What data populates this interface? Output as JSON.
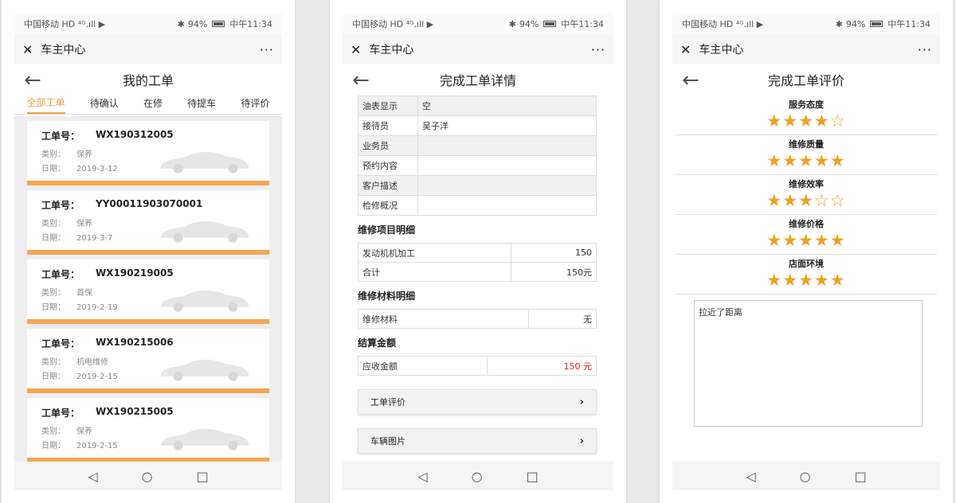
{
  "status": {
    "carrier": "中国移动",
    "carrier_tags": "HD ⁴ᴳ.ıll ▶",
    "battery": "94%",
    "time": "中午11:34"
  },
  "wx": {
    "title": "车主中心",
    "close": "✕",
    "more": "···"
  },
  "icons": {
    "back": "arrow-left-icon",
    "close": "close-icon",
    "more": "more-icon"
  },
  "colors": {
    "accent": "#f0a048",
    "card_bar": "#f4a751",
    "amount": "#d22222",
    "star": "#f0a020"
  },
  "nav": {
    "back": "◁",
    "home": "○",
    "recent": "□"
  },
  "phone1": {
    "title": "我的工单",
    "tabs": [
      "全部工单",
      "待确认",
      "在修",
      "待提车",
      "待评价"
    ],
    "orders": [
      {
        "no_label": "工单号：",
        "no": "WX190312005",
        "type_label": "类别：",
        "type": "保养",
        "date_label": "日期：",
        "date": "2019-3-12"
      },
      {
        "no_label": "工单号：",
        "no": "YY00011903070001",
        "type_label": "类别：",
        "type": "保养",
        "date_label": "日期：",
        "date": "2019-3-7"
      },
      {
        "no_label": "工单号：",
        "no": "WX190219005",
        "type_label": "类别：",
        "type": "首保",
        "date_label": "日期：",
        "date": "2019-2-19"
      },
      {
        "no_label": "工单号：",
        "no": "WX190215006",
        "type_label": "类别：",
        "type": "机电维修",
        "date_label": "日期：",
        "date": "2019-2-15"
      },
      {
        "no_label": "工单号：",
        "no": "WX190215005",
        "type_label": "类别：",
        "type": "保养",
        "date_label": "日期：",
        "date": "2019-2-15"
      }
    ]
  },
  "phone2": {
    "title": "完成工单详情",
    "info": [
      {
        "k": "油表显示",
        "v": "空"
      },
      {
        "k": "接待员",
        "v": "吴子洋"
      },
      {
        "k": "业务员",
        "v": ""
      },
      {
        "k": "预约内容",
        "v": ""
      },
      {
        "k": "客户描述",
        "v": ""
      },
      {
        "k": "检修概况",
        "v": ""
      }
    ],
    "items_title": "维修项目明细",
    "items": [
      {
        "k": "发动机机加工",
        "v": "150"
      },
      {
        "k": "合计",
        "v": "150元"
      }
    ],
    "materials_title": "维修材料明细",
    "materials": [
      {
        "k": "维修材料",
        "v": "无"
      }
    ],
    "settle_title": "结算金额",
    "settle": {
      "k": "应收金额",
      "v": "150 元"
    },
    "btn_review": "工单评价",
    "btn_photos": "车辆图片",
    "chev": "›"
  },
  "phone3": {
    "title": "完成工单评价",
    "ratings": [
      {
        "label": "服务态度",
        "stars": "★★★★☆"
      },
      {
        "label": "维修质量",
        "stars": "★★★★★"
      },
      {
        "label": "维修效率",
        "stars": "★★★☆☆"
      },
      {
        "label": "维修价格",
        "stars": "★★★★★"
      },
      {
        "label": "店面环境",
        "stars": "★★★★★"
      }
    ],
    "comment": "拉近了距离"
  }
}
